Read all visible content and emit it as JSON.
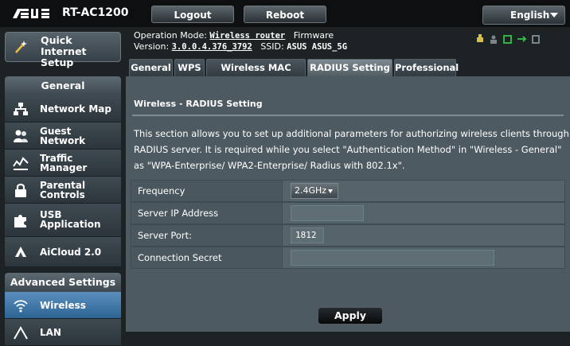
{
  "header": {
    "brand": "/ISUS",
    "model": "RT-AC1200",
    "logout_label": "Logout",
    "reboot_label": "Reboot",
    "language": "English"
  },
  "sidebar": {
    "qis_label": "Quick Internet Setup",
    "general_heading": "General",
    "general_items": [
      {
        "label": "Network Map",
        "icon": "network-map-icon"
      },
      {
        "label": "Guest Network",
        "icon": "guest-network-icon"
      },
      {
        "label": "Traffic Manager",
        "icon": "traffic-manager-icon"
      },
      {
        "label": "Parental Controls",
        "icon": "parental-controls-icon"
      },
      {
        "label": "USB Application",
        "icon": "usb-application-icon"
      },
      {
        "label": "AiCloud 2.0",
        "icon": "aicloud-icon"
      }
    ],
    "advanced_heading": "Advanced Settings",
    "advanced_items": [
      {
        "label": "Wireless",
        "icon": "wireless-icon",
        "active": true
      },
      {
        "label": "LAN",
        "icon": "lan-icon"
      }
    ]
  },
  "status": {
    "operation_mode_label": "Operation Mode:",
    "operation_mode": "Wireless router",
    "firmware_label": "Firmware",
    "version_label": "Version:",
    "version": "3.0.0.4.376_3792",
    "ssid_label": "SSID:",
    "ssid": "ASUS ASUS_5G"
  },
  "tabs": [
    {
      "label": "General"
    },
    {
      "label": "WPS"
    },
    {
      "label": "Wireless MAC Filter"
    },
    {
      "label": "RADIUS Setting",
      "active": true
    },
    {
      "label": "Professional"
    }
  ],
  "content": {
    "title": "Wireless - RADIUS Setting",
    "description": "This section allows you to set up additional parameters for authorizing wireless clients through RADIUS server. It is required while you select \"Authentication Method\" in \"Wireless - General\" as \"WPA-Enterprise/ WPA2-Enterprise/ Radius with 802.1x\".",
    "form": {
      "frequency_label": "Frequency",
      "frequency_value": "2.4GHz",
      "server_ip_label": "Server IP Address",
      "server_ip_value": "",
      "server_port_label": "Server Port:",
      "server_port_value": "1812",
      "secret_label": "Connection Secret",
      "secret_value": ""
    },
    "apply_label": "Apply"
  },
  "colors": {
    "accent_active": "#4a86b8",
    "panel": "#4d5a61",
    "background": "#1d2225"
  }
}
